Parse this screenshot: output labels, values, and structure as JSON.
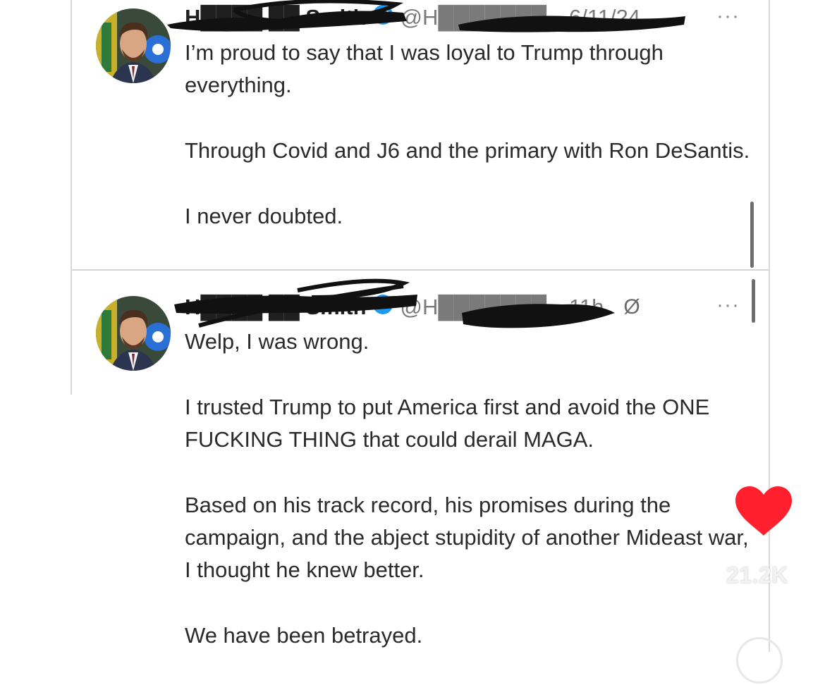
{
  "tweets": [
    {
      "name": "H████ ██ Smith",
      "handle": "@H███████...",
      "time": "6/11/24",
      "more_label": "···",
      "body": [
        "I’m proud to say that I was loyal to Trump through everything.",
        "Through Covid and J6 and the primary with Ron DeSantis.",
        "I never doubted."
      ]
    },
    {
      "name": "H████ ██ Smith",
      "handle": "@H███████...",
      "time": "11h",
      "grok_icon": "Ø",
      "more_label": "···",
      "body": [
        "Welp, I was wrong.",
        "I trusted Trump to put America first and avoid the ONE FUCKING THING that could derail MAGA.",
        "Based on his track record, his promises during the campaign, and the abject stupidity of another Mideast war, I thought he knew better.",
        "We have been betrayed."
      ]
    }
  ],
  "overlay": {
    "like_count": "21.2K",
    "like_color": "#ff1f2d"
  },
  "colors": {
    "verified": "#1d9bf0",
    "text": "#2a2a2a",
    "muted": "#7a7a7a"
  }
}
